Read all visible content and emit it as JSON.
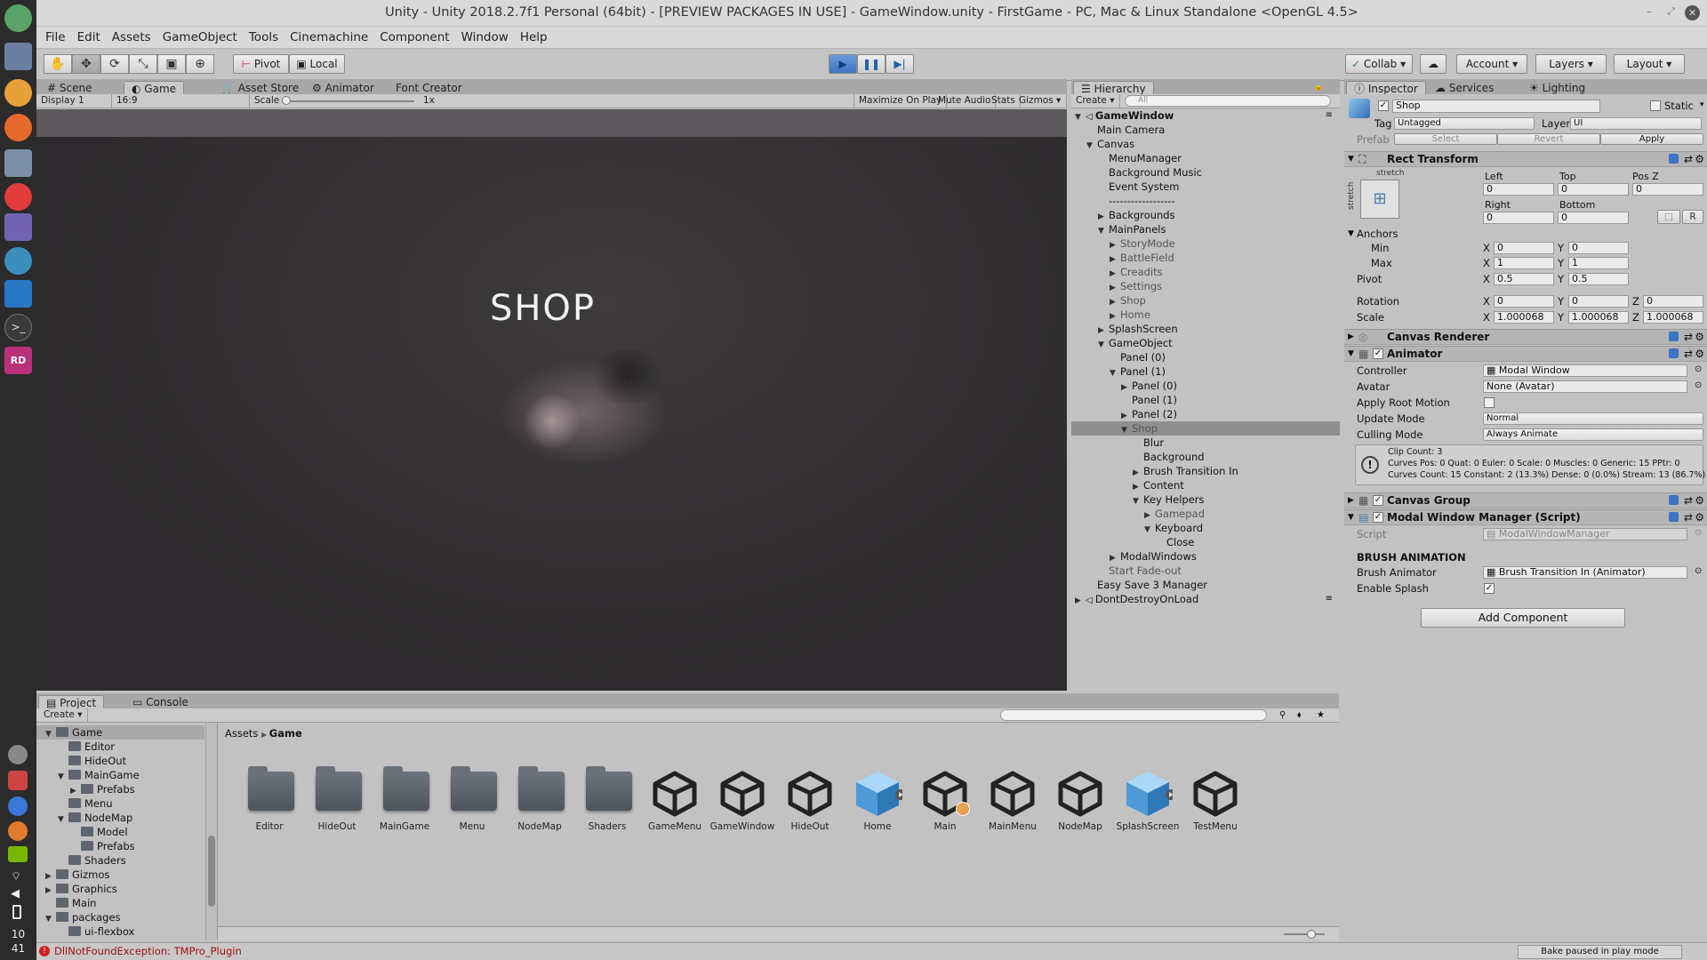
{
  "window": {
    "title": "Unity - Unity 2018.2.7f1 Personal (64bit) - [PREVIEW PACKAGES IN USE] - GameWindow.unity - FirstGame - PC, Mac & Linux Standalone <OpenGL 4.5>"
  },
  "dock": {
    "clock_hour": "10",
    "clock_min": "41",
    "rd_label": "RD"
  },
  "menu": {
    "items": [
      "File",
      "Edit",
      "Assets",
      "GameObject",
      "Tools",
      "Cinemachine",
      "Component",
      "Window",
      "Help"
    ]
  },
  "toolbar": {
    "pivot": "Pivot",
    "local": "Local",
    "collab": "Collab",
    "account": "Account",
    "layers": "Layers",
    "layout": "Layout"
  },
  "scene_tabs": {
    "scene": "Scene",
    "game": "Game",
    "asset_store": "Asset Store",
    "animator": "Animator",
    "font_creator": "Font Creator"
  },
  "game_bar": {
    "display": "Display 1",
    "aspect": "16:9",
    "scale_label": "Scale",
    "scale_value": "1x",
    "maximize": "Maximize On Play",
    "mute": "Mute Audio",
    "stats": "Stats",
    "gizmos": "Gizmos"
  },
  "game_view": {
    "heading": "SHOP"
  },
  "hierarchy": {
    "tab": "Hierarchy",
    "create": "Create",
    "search_placeholder": "All",
    "rows": [
      {
        "label": "GameWindow",
        "indent": 0,
        "arrow": "▼",
        "bold": true,
        "scene": true
      },
      {
        "label": "Main Camera",
        "indent": 1,
        "arrow": ""
      },
      {
        "label": "Canvas",
        "indent": 1,
        "arrow": "▼"
      },
      {
        "label": "MenuManager",
        "indent": 2,
        "arrow": ""
      },
      {
        "label": "Background Music",
        "indent": 2,
        "arrow": ""
      },
      {
        "label": "Event System",
        "indent": 2,
        "arrow": ""
      },
      {
        "label": "------------------",
        "indent": 2,
        "arrow": ""
      },
      {
        "label": "Backgrounds",
        "indent": 2,
        "arrow": "▶"
      },
      {
        "label": "MainPanels",
        "indent": 2,
        "arrow": "▼"
      },
      {
        "label": "StoryMode",
        "indent": 3,
        "arrow": "▶",
        "dim": true
      },
      {
        "label": "BattleField",
        "indent": 3,
        "arrow": "▶",
        "dim": true
      },
      {
        "label": "Creadits",
        "indent": 3,
        "arrow": "▶",
        "dim": true
      },
      {
        "label": "Settings",
        "indent": 3,
        "arrow": "▶",
        "dim": true
      },
      {
        "label": "Shop",
        "indent": 3,
        "arrow": "▶",
        "dim": true
      },
      {
        "label": "Home",
        "indent": 3,
        "arrow": "▶",
        "dim": true
      },
      {
        "label": "SplashScreen",
        "indent": 2,
        "arrow": "▶"
      },
      {
        "label": "GameObject",
        "indent": 2,
        "arrow": "▼"
      },
      {
        "label": "Panel (0)",
        "indent": 3,
        "arrow": ""
      },
      {
        "label": "Panel (1)",
        "indent": 3,
        "arrow": "▼"
      },
      {
        "label": "Panel (0)",
        "indent": 4,
        "arrow": "▶"
      },
      {
        "label": "Panel (1)",
        "indent": 4,
        "arrow": ""
      },
      {
        "label": "Panel (2)",
        "indent": 4,
        "arrow": "▶"
      },
      {
        "label": "Shop",
        "indent": 4,
        "arrow": "▼",
        "selected": true,
        "dim": true
      },
      {
        "label": "Blur",
        "indent": 5,
        "arrow": ""
      },
      {
        "label": "Background",
        "indent": 5,
        "arrow": ""
      },
      {
        "label": "Brush Transition In",
        "indent": 5,
        "arrow": "▶"
      },
      {
        "label": "Content",
        "indent": 5,
        "arrow": "▶"
      },
      {
        "label": "Key Helpers",
        "indent": 5,
        "arrow": "▼"
      },
      {
        "label": "Gamepad",
        "indent": 6,
        "arrow": "▶",
        "dim": true
      },
      {
        "label": "Keyboard",
        "indent": 6,
        "arrow": "▼"
      },
      {
        "label": "Close",
        "indent": 7,
        "arrow": ""
      },
      {
        "label": "ModalWindows",
        "indent": 3,
        "arrow": "▶"
      },
      {
        "label": "Start Fade-out",
        "indent": 2,
        "arrow": "",
        "dim": true
      },
      {
        "label": "Easy Save 3 Manager",
        "indent": 1,
        "arrow": ""
      },
      {
        "label": "DontDestroyOnLoad",
        "indent": 0,
        "arrow": "▶",
        "scene": true
      }
    ]
  },
  "inspector": {
    "tabs": {
      "inspector": "Inspector",
      "services": "Services",
      "lighting": "Lighting"
    },
    "object_name": "Shop",
    "static": "Static",
    "tag_label": "Tag",
    "tag_value": "Untagged",
    "layer_label": "Layer",
    "layer_value": "UI",
    "prefab_label": "Prefab",
    "prefab_select": "Select",
    "prefab_revert": "Revert",
    "prefab_apply": "Apply",
    "rect": {
      "title": "Rect Transform",
      "stretch": "stretch",
      "stretch_side": "stretch",
      "left": "Left",
      "top": "Top",
      "posz": "Pos Z",
      "right": "Right",
      "bottom": "Bottom",
      "left_v": "0",
      "top_v": "0",
      "posz_v": "0",
      "right_v": "0",
      "bottom_v": "0",
      "r_btn": "R",
      "anchors": "Anchors",
      "min": "Min",
      "max": "Max",
      "pivot": "Pivot",
      "rotation": "Rotation",
      "scale": "Scale",
      "x": "X",
      "y": "Y",
      "z": "Z",
      "min_x": "0",
      "min_y": "0",
      "max_x": "1",
      "max_y": "1",
      "pivot_x": "0.5",
      "pivot_y": "0.5",
      "rot_x": "0",
      "rot_y": "0",
      "rot_z": "0",
      "scale_x": "1.000068",
      "scale_y": "1.000068",
      "scale_z": "1.000068"
    },
    "canvas_renderer": "Canvas Renderer",
    "animator": {
      "title": "Animator",
      "controller": "Controller",
      "controller_v": "Modal Window",
      "avatar": "Avatar",
      "avatar_v": "None (Avatar)",
      "apply_root": "Apply Root Motion",
      "update_mode": "Update Mode",
      "update_v": "Normal",
      "culling": "Culling Mode",
      "culling_v": "Always Animate",
      "info1": "Clip Count: 3",
      "info2": "Curves Pos: 0 Quat: 0 Euler: 0 Scale: 0 Muscles: 0 Generic: 15 PPtr: 0",
      "info3": "Curves Count: 15 Constant: 2 (13.3%) Dense: 0 (0.0%) Stream: 13 (86.7%)"
    },
    "canvas_group": "Canvas Group",
    "modal": {
      "title": "Modal Window Manager (Script)",
      "script": "Script",
      "script_v": "ModalWindowManager",
      "section": "BRUSH ANIMATION",
      "brush": "Brush Animator",
      "brush_v": "Brush Transition In (Animator)",
      "splash": "Enable Splash"
    },
    "add_component": "Add Component"
  },
  "project": {
    "tabs": {
      "project": "Project",
      "console": "Console"
    },
    "create": "Create",
    "tree": [
      {
        "label": "Game",
        "indent": 0,
        "arrow": "▼",
        "selected": true
      },
      {
        "label": "Editor",
        "indent": 1,
        "arrow": ""
      },
      {
        "label": "HideOut",
        "indent": 1,
        "arrow": ""
      },
      {
        "label": "MainGame",
        "indent": 1,
        "arrow": "▼"
      },
      {
        "label": "Prefabs",
        "indent": 2,
        "arrow": "▶"
      },
      {
        "label": "Menu",
        "indent": 1,
        "arrow": ""
      },
      {
        "label": "NodeMap",
        "indent": 1,
        "arrow": "▼"
      },
      {
        "label": "Model",
        "indent": 2,
        "arrow": ""
      },
      {
        "label": "Prefabs",
        "indent": 2,
        "arrow": ""
      },
      {
        "label": "Shaders",
        "indent": 1,
        "arrow": ""
      },
      {
        "label": "Gizmos",
        "indent": 0,
        "arrow": "▶"
      },
      {
        "label": "Graphics",
        "indent": 0,
        "arrow": "▶"
      },
      {
        "label": "Main",
        "indent": 0,
        "arrow": ""
      },
      {
        "label": "packages",
        "indent": 0,
        "arrow": "▼"
      },
      {
        "label": "ui-flexbox",
        "indent": 1,
        "arrow": ""
      }
    ],
    "breadcrumb": {
      "root": "Assets",
      "current": "Game"
    },
    "assets": [
      {
        "label": "Editor",
        "type": "folder"
      },
      {
        "label": "HideOut",
        "type": "folder"
      },
      {
        "label": "MainGame",
        "type": "folder"
      },
      {
        "label": "Menu",
        "type": "folder"
      },
      {
        "label": "NodeMap",
        "type": "folder"
      },
      {
        "label": "Shaders",
        "type": "folder"
      },
      {
        "label": "GameMenu",
        "type": "scene"
      },
      {
        "label": "GameWindow",
        "type": "scene"
      },
      {
        "label": "HideOut",
        "type": "scene"
      },
      {
        "label": "Home",
        "type": "prefab"
      },
      {
        "label": "Main",
        "type": "scene"
      },
      {
        "label": "MainMenu",
        "type": "scene"
      },
      {
        "label": "NodeMap",
        "type": "scene"
      },
      {
        "label": "SplashScreen",
        "type": "prefab"
      },
      {
        "label": "TestMenu",
        "type": "scene"
      }
    ]
  },
  "status": {
    "error": "DllNotFoundException: TMPro_Plugin",
    "bake": "Bake paused in play mode"
  }
}
